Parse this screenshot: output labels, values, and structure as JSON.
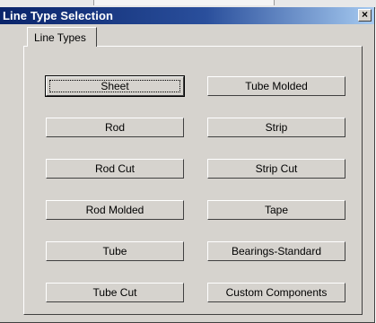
{
  "window": {
    "title": "Line Type Selection",
    "close_glyph": "×",
    "close_icon": "close-icon"
  },
  "tabs": [
    {
      "label": "Line Types",
      "active": true
    }
  ],
  "buttons": {
    "left": [
      "Sheet",
      "Rod",
      "Rod Cut",
      "Rod Molded",
      "Tube",
      "Tube Cut"
    ],
    "right": [
      "Tube Molded",
      "Strip",
      "Strip Cut",
      "Tape",
      "Bearings-Standard",
      "Custom Components"
    ]
  },
  "colors": {
    "titlebar_start": "#0a246a",
    "titlebar_end": "#a6caf0",
    "face": "#d6d3ce"
  }
}
